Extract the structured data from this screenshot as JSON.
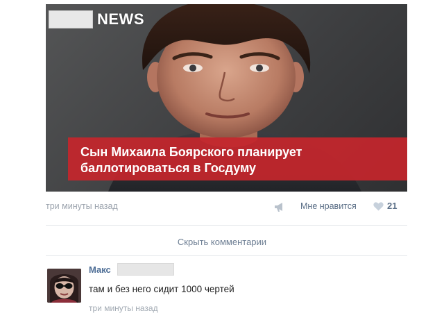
{
  "news_card": {
    "logo_text": "NEWS",
    "headline": "Сын Михаила Боярского планирует баллотироваться в Госдуму",
    "image_subject": "portrait-photo"
  },
  "meta": {
    "time": "три минуты назад",
    "like_label": "Мне нравится",
    "like_count": "21",
    "share_icon": "megaphone-icon",
    "like_icon": "heart-icon"
  },
  "comments_toggle": {
    "label": "Скрыть комментарии"
  },
  "comment": {
    "author": "Макс",
    "text": "там и без него сидит 1000 чертей",
    "time": "три минуты назад",
    "avatar": "avatar-image"
  },
  "colors": {
    "headline_band": "#c4262c",
    "link": "#5a6e86",
    "muted": "#9ba3ad"
  }
}
